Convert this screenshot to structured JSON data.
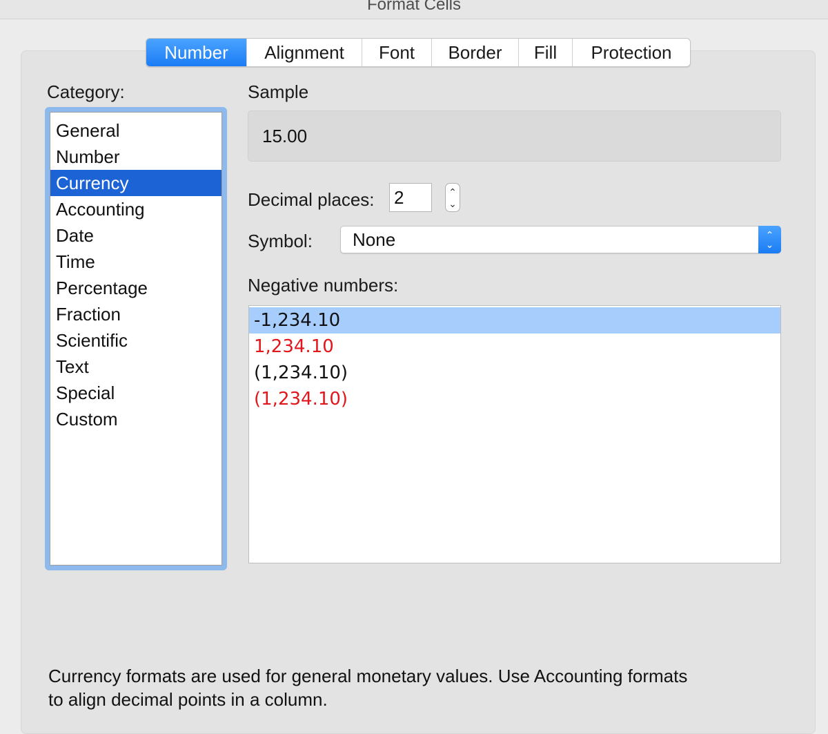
{
  "window": {
    "title": "Format Cells"
  },
  "tabs": [
    {
      "label": "Number",
      "active": true
    },
    {
      "label": "Alignment",
      "active": false
    },
    {
      "label": "Font",
      "active": false
    },
    {
      "label": "Border",
      "active": false
    },
    {
      "label": "Fill",
      "active": false
    },
    {
      "label": "Protection",
      "active": false
    }
  ],
  "category": {
    "label": "Category:",
    "items": [
      "General",
      "Number",
      "Currency",
      "Accounting",
      "Date",
      "Time",
      "Percentage",
      "Fraction",
      "Scientific",
      "Text",
      "Special",
      "Custom"
    ],
    "selected": "Currency"
  },
  "sample": {
    "label": "Sample",
    "value": "15.00"
  },
  "decimal_places": {
    "label": "Decimal places:",
    "value": "2"
  },
  "symbol": {
    "label": "Symbol:",
    "value": "None"
  },
  "negative_numbers": {
    "label": "Negative numbers:",
    "items": [
      {
        "text": "-1,234.10",
        "color": "#111111",
        "selected": true
      },
      {
        "text": "1,234.10",
        "color": "#e0171c",
        "selected": false
      },
      {
        "text": "(1,234.10)",
        "color": "#111111",
        "selected": false
      },
      {
        "text": "(1,234.10)",
        "color": "#e0171c",
        "selected": false
      }
    ]
  },
  "description": {
    "line1": "Currency formats are used for general monetary values.  Use Accounting formats",
    "line2": "to align decimal points in a column."
  },
  "colors": {
    "accent": "#1b7cf5",
    "selection": "#1c63d5",
    "negative_selection": "#a6cdfb",
    "negative_red": "#e0171c"
  },
  "icons": {
    "stepper": "stepper-icon",
    "select_arrows": "chevron-up-down-icon"
  }
}
